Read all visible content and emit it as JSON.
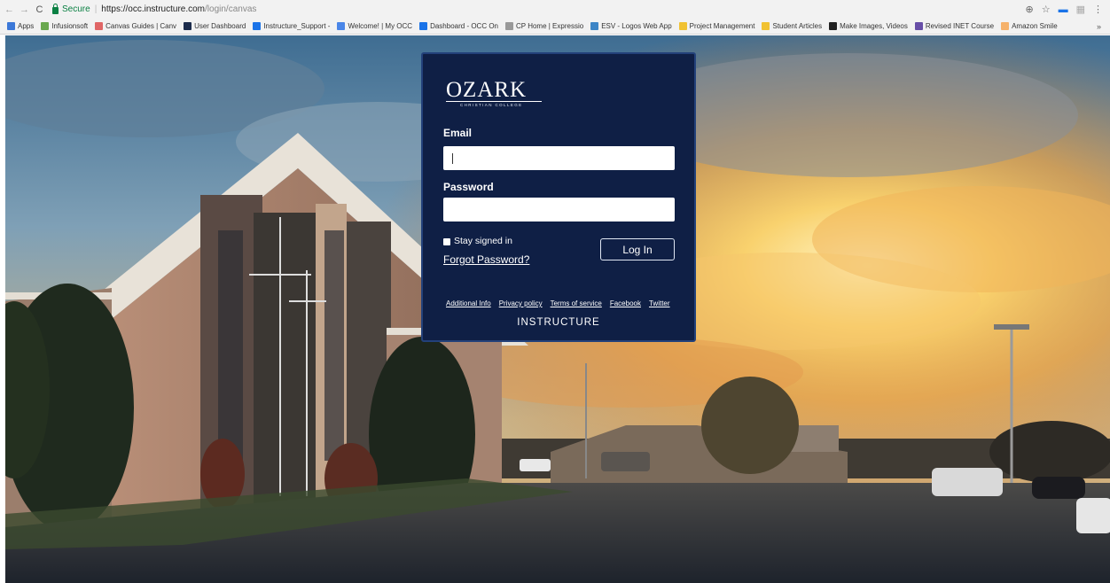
{
  "browser": {
    "nav": {
      "back": "←",
      "forward": "→",
      "reload": "C"
    },
    "secure_label": "Secure",
    "url_host": "https://occ.instructure.com",
    "url_path": "/login/canvas",
    "right_icons": [
      "zoom-icon",
      "star-icon",
      "extension-icon",
      "extension-gray-icon",
      "menu-icon"
    ],
    "bookmarks": [
      {
        "label": "Apps",
        "icon_color": "#3c78d8"
      },
      {
        "label": "Infusionsoft",
        "icon_color": "#6aa84f"
      },
      {
        "label": "Canvas Guides | Canv",
        "icon_color": "#e06666"
      },
      {
        "label": "User Dashboard",
        "icon_color": "#1c2c4c"
      },
      {
        "label": "Instructure_Support -",
        "icon_color": "#1a73e8"
      },
      {
        "label": "Welcome! | My OCC",
        "icon_color": "#4a86e8"
      },
      {
        "label": "Dashboard - OCC On",
        "icon_color": "#1a73e8"
      },
      {
        "label": "CP Home | Expressio",
        "icon_color": "#999999"
      },
      {
        "label": "ESV - Logos Web App",
        "icon_color": "#3d85c6"
      },
      {
        "label": "Project Management",
        "icon_color": "#f1c232"
      },
      {
        "label": "Student Articles",
        "icon_color": "#f1c232"
      },
      {
        "label": "Make Images, Videos",
        "icon_color": "#222222"
      },
      {
        "label": "Revised INET Course",
        "icon_color": "#674ea7"
      },
      {
        "label": "Amazon Smile",
        "icon_color": "#f6b26b"
      }
    ],
    "bookmarks_more": "»"
  },
  "login": {
    "logo_word": "OZARK",
    "logo_sub": "CHRISTIAN COLLEGE",
    "email_label": "Email",
    "email_value": "",
    "password_label": "Password",
    "password_value": "",
    "stay_signed_in": "Stay signed in",
    "forgot_password": "Forgot Password?",
    "login_button": "Log In",
    "footer_links": [
      "Additional Info",
      "Privacy policy",
      "Terms of service",
      "Facebook",
      "Twitter"
    ],
    "brand": "INSTRUCTURE"
  },
  "colors": {
    "panel_bg": "#0f1f45",
    "panel_border": "#23417a",
    "secure_green": "#0b8043"
  }
}
